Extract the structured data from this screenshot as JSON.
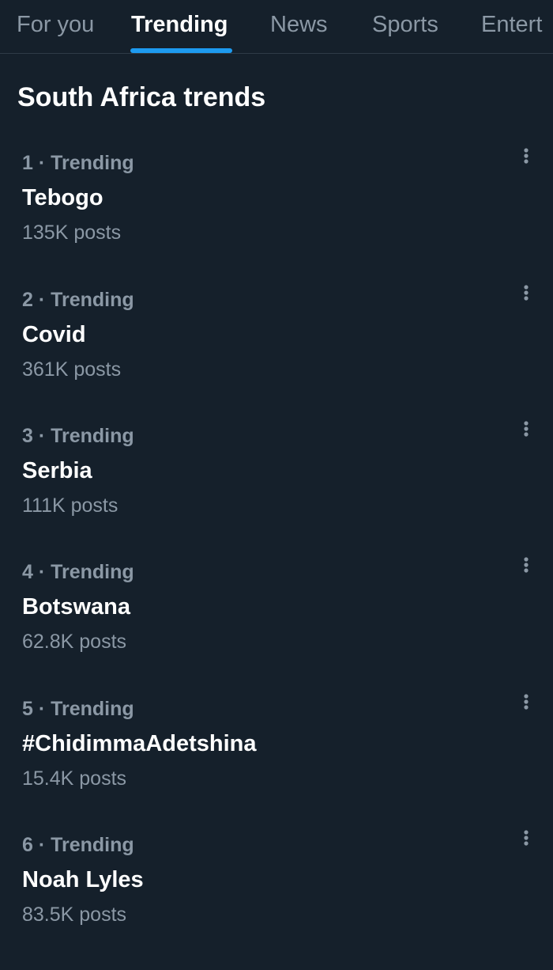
{
  "tabs": [
    {
      "label": "For you",
      "active": false
    },
    {
      "label": "Trending",
      "active": true
    },
    {
      "label": "News",
      "active": false
    },
    {
      "label": "Sports",
      "active": false
    },
    {
      "label": "Entert",
      "active": false
    }
  ],
  "section": {
    "title": "South Africa trends"
  },
  "trends": [
    {
      "meta": "1 · Trending",
      "name": "Tebogo",
      "count": "135K posts"
    },
    {
      "meta": "2 · Trending",
      "name": "Covid",
      "count": "361K posts"
    },
    {
      "meta": "3 · Trending",
      "name": "Serbia",
      "count": "111K posts"
    },
    {
      "meta": "4 · Trending",
      "name": "Botswana",
      "count": "62.8K posts"
    },
    {
      "meta": "5 · Trending",
      "name": "#ChidimmaAdetshina",
      "count": "15.4K posts"
    },
    {
      "meta": "6 · Trending",
      "name": "Noah Lyles",
      "count": "83.5K posts"
    }
  ],
  "icons": {
    "more": "more-horizontal-dots-icon"
  },
  "colors": {
    "background": "#15202b",
    "accent": "#1d9bf0",
    "secondary_text": "#8b98a5",
    "primary_text": "#ffffff"
  }
}
